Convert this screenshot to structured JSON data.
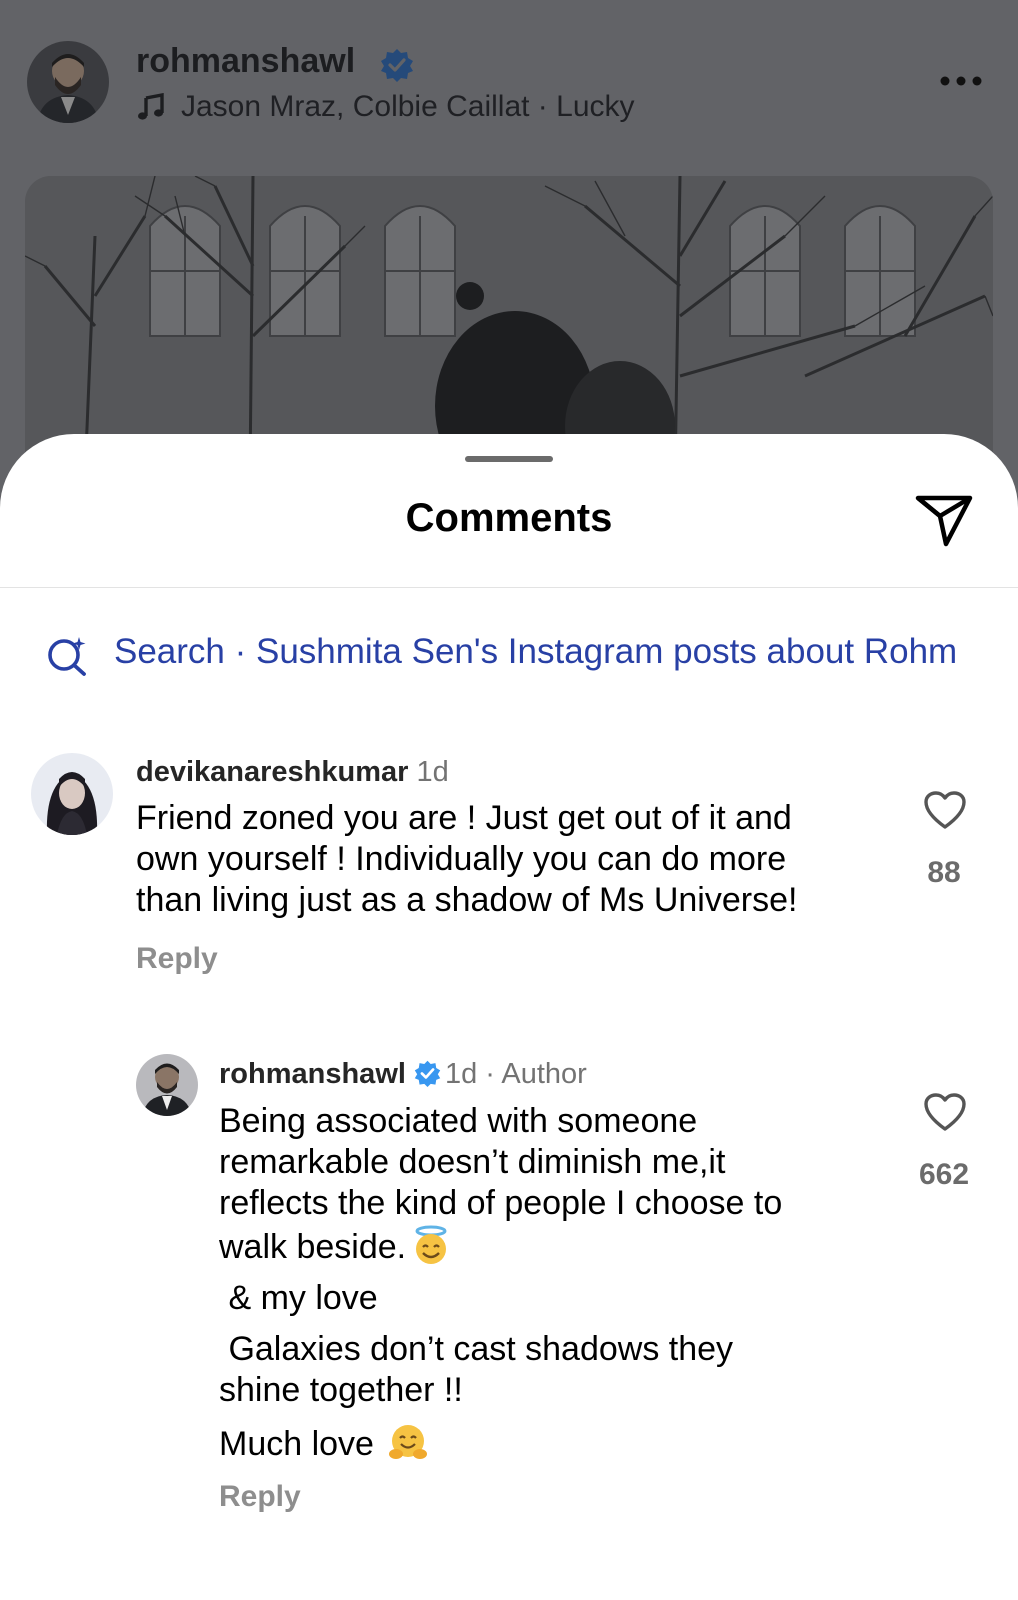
{
  "post": {
    "username": "rohmanshawl",
    "song": "Jason Mraz, Colbie Caillat · Lucky",
    "avatar_icon": "profile-photo",
    "verified_icon": "verified-badge-icon",
    "more_icon": "more-options-icon"
  },
  "sheet": {
    "title": "Comments",
    "share_icon": "send-icon"
  },
  "search": {
    "icon": "search-sparkle-icon",
    "text": "Search · Sushmita Sen's Instagram posts about Rohm"
  },
  "comments": [
    {
      "username": "devikanareshkumar",
      "time": "1d",
      "lines": [
        "Friend zoned you are ! Just get out of it and",
        "own yourself ! Individually you can do more",
        "than living just as a shadow of Ms Universe!"
      ],
      "reply_label": "Reply",
      "likes": "88"
    },
    {
      "username": "rohmanshawl",
      "time": "1d",
      "author_tag": "· Author",
      "lines": [
        "Being associated with someone",
        "remarkable doesn’t diminish me,it",
        "reflects the kind of people I choose to",
        "walk beside."
      ],
      "extra": [
        " & my love",
        " Galaxies don’t cast shadows they",
        "shine together !!",
        "Much love"
      ],
      "reply_label": "Reply",
      "likes": "662"
    }
  ],
  "colors": {
    "dim_overlay": "#626367",
    "search_link": "#2840a5",
    "verified": "#3897f0",
    "meta_gray": "#737373"
  }
}
